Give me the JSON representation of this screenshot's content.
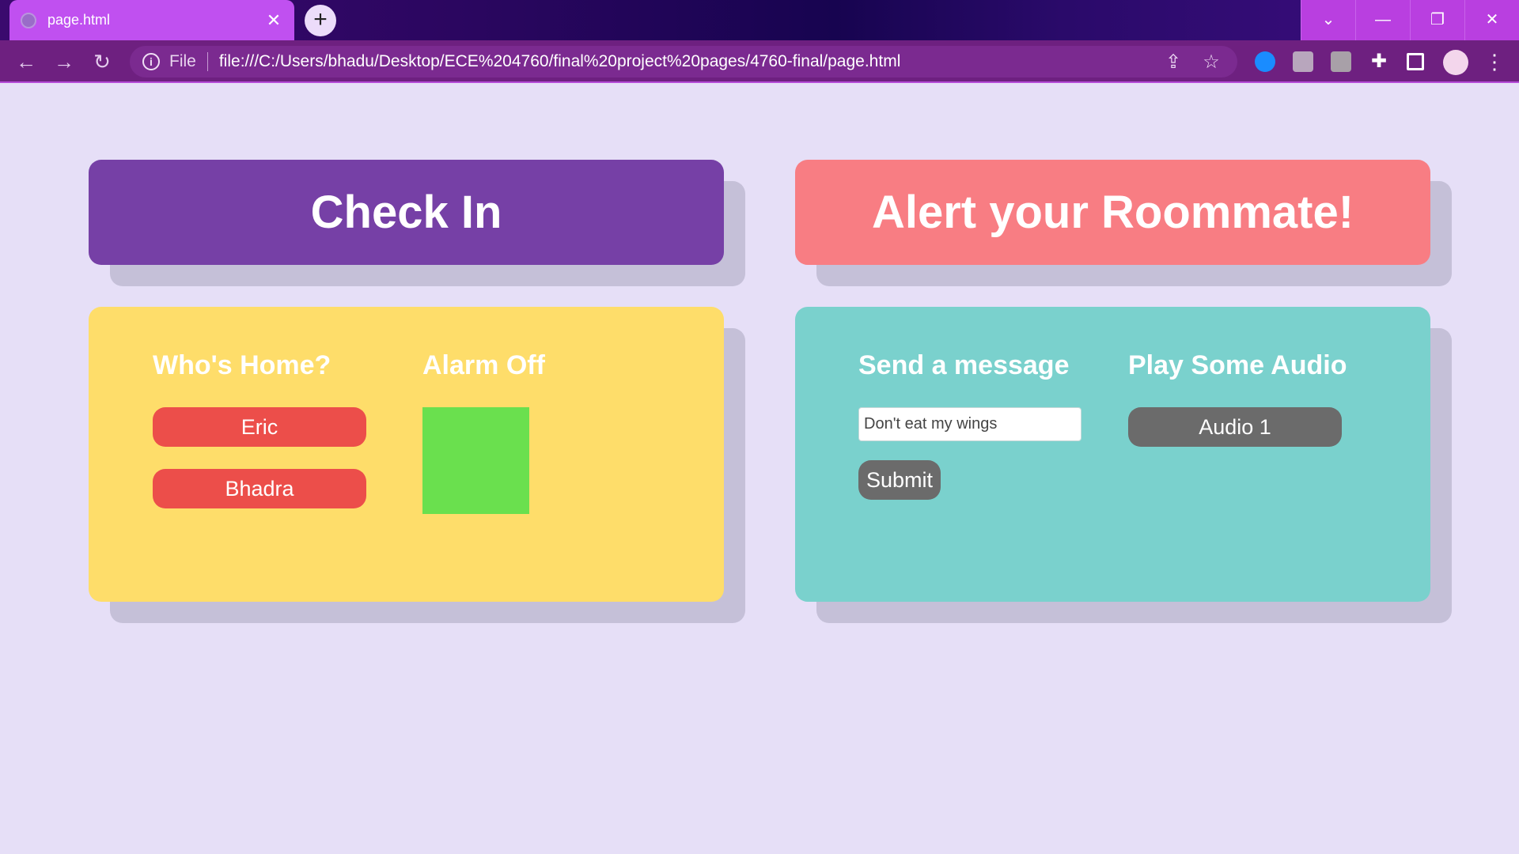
{
  "browser": {
    "tab_title": "page.html",
    "tab_close": "✕",
    "new_tab": "+",
    "omnibox": {
      "scheme_label": "File",
      "url": "file:///C:/Users/bhadu/Desktop/ECE%204760/final%20project%20pages/4760-final/page.html"
    },
    "window_controls": {
      "dropdown": "⌄",
      "minimize": "—",
      "restore": "❐",
      "close": "✕"
    },
    "nav": {
      "back": "←",
      "forward": "→",
      "reload": "↻"
    }
  },
  "check_in": {
    "header": "Check In",
    "whos_home": {
      "title": "Who's Home?",
      "people": [
        "Eric",
        "Bhadra"
      ],
      "button_color": "#ec4e4a"
    },
    "alarm": {
      "title": "Alarm Off",
      "indicator_color": "#6ae04e"
    },
    "header_color": "#7640a6",
    "panel_color": "#fedd6a"
  },
  "alert": {
    "header": "Alert your Roommate!",
    "message": {
      "title": "Send a message",
      "input_value": "Don't eat my wings",
      "submit_label": "Submit"
    },
    "audio": {
      "title": "Play Some Audio",
      "buttons": [
        "Audio 1"
      ]
    },
    "header_color": "#f87d83",
    "panel_color": "#7ad1cd",
    "button_color": "#6b6b6b"
  }
}
